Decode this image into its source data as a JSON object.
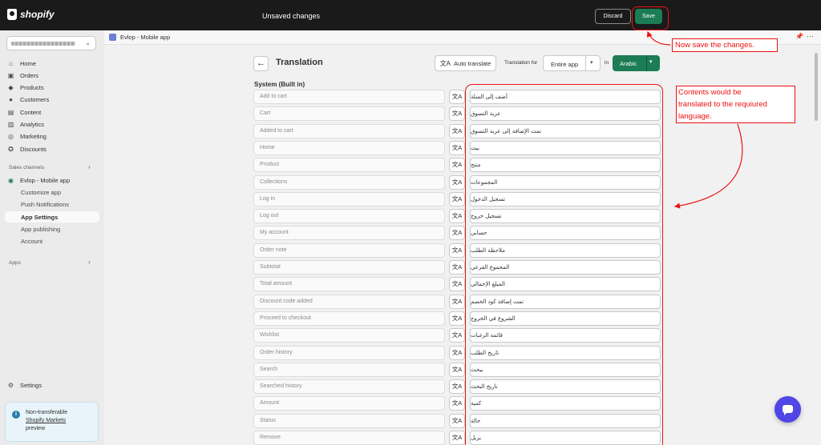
{
  "topbar": {
    "logo": "shopify",
    "status": "Unsaved changes",
    "discard_label": "Discard",
    "save_label": "Save"
  },
  "sidebar": {
    "nav": [
      {
        "label": "Home",
        "icon": "home-icon"
      },
      {
        "label": "Orders",
        "icon": "orders-icon"
      },
      {
        "label": "Products",
        "icon": "tag-icon"
      },
      {
        "label": "Customers",
        "icon": "person-icon"
      },
      {
        "label": "Content",
        "icon": "content-icon"
      },
      {
        "label": "Analytics",
        "icon": "chart-icon"
      },
      {
        "label": "Marketing",
        "icon": "target-icon"
      },
      {
        "label": "Discounts",
        "icon": "discount-icon"
      }
    ],
    "sales_channels_label": "Sales channels",
    "app_name": "Evlop - Mobile app",
    "app_subitems": [
      "Customize app",
      "Push Notifications",
      "App Settings",
      "App publishing",
      "Account"
    ],
    "active_subitem": "App Settings",
    "apps_label": "Apps",
    "settings_label": "Settings",
    "notice": {
      "line1": "Non-transferable",
      "link": "Shopify Markets",
      "line3": "preview"
    }
  },
  "appbar": {
    "title": "Evlop - Mobile app"
  },
  "page": {
    "title": "Translation",
    "auto_translate_label": "Auto translate",
    "translation_for_label": "Translation for",
    "scope_value": "Entire app",
    "in_label": "in",
    "language_value": "Arabic",
    "section_title": "System (Built in)"
  },
  "rows": [
    {
      "source": "Add to cart",
      "translation": "أضف إلى السلة"
    },
    {
      "source": "Cart",
      "translation": "عربة التسوق"
    },
    {
      "source": "Added to cart",
      "translation": "تمت الإضافة إلى عربة التسوق"
    },
    {
      "source": "Home",
      "translation": "بيت"
    },
    {
      "source": "Product",
      "translation": "منتج"
    },
    {
      "source": "Collections",
      "translation": "المجموعات"
    },
    {
      "source": "Log in",
      "translation": "تسجيل الدخول"
    },
    {
      "source": "Log out",
      "translation": "تسجيل خروج"
    },
    {
      "source": "My account",
      "translation": "حسابي"
    },
    {
      "source": "Order note",
      "translation": "ملاحظة الطلب"
    },
    {
      "source": "Subtotal",
      "translation": "المجموع الفرعي"
    },
    {
      "source": "Total amount",
      "translation": "المبلغ الإجمالي"
    },
    {
      "source": "Discount code added",
      "translation": "تمت إضافة كود الخصم"
    },
    {
      "source": "Proceed to checkout",
      "translation": "الشروع في الخروج"
    },
    {
      "source": "Wishlist",
      "translation": "قائمة الرغبات"
    },
    {
      "source": "Order history",
      "translation": "تاريخ الطلب"
    },
    {
      "source": "Search",
      "translation": "يبحث"
    },
    {
      "source": "Searched history",
      "translation": "تاريخ البحث"
    },
    {
      "source": "Amount",
      "translation": "كمية"
    },
    {
      "source": "Status",
      "translation": "حالة"
    },
    {
      "source": "Remove",
      "translation": "يزيل"
    }
  ],
  "annotations": {
    "save_note": "Now save the changes.",
    "translate_note": [
      "Contents would be",
      "translated to the requiured",
      "language."
    ]
  },
  "colors": {
    "topbar": "#1a1a1a",
    "primary_green": "#1c7c54",
    "annotation_red": "#ee1111",
    "chat_button": "#4f46e5"
  }
}
